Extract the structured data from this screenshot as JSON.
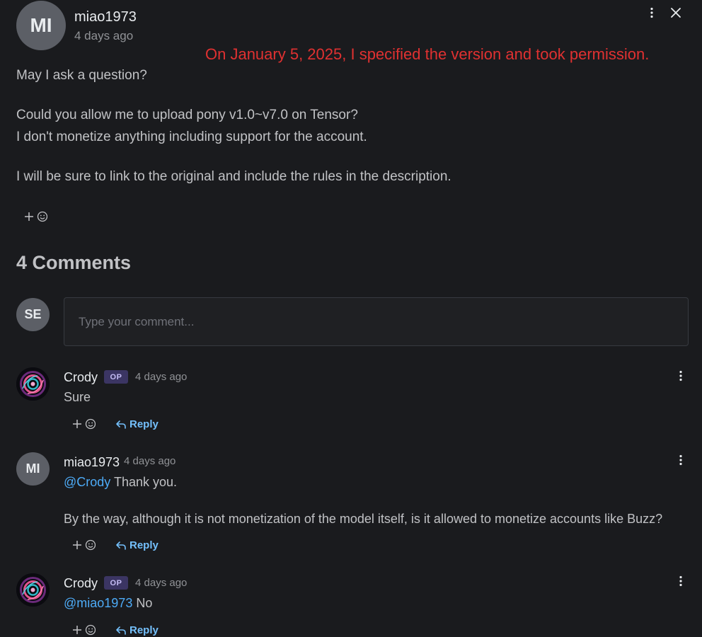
{
  "post": {
    "avatar_initials": "MI",
    "author": "miao1973",
    "time": "4 days ago",
    "annotation": "On January 5, 2025, I specified the version and took permission.",
    "body": [
      "May I ask a question?",
      "Could you allow me to upload pony v1.0~v7.0 on Tensor?",
      "I don't monetize anything including support for the account.",
      "I will be sure to link to the original and include the rules in the description."
    ]
  },
  "comments_section": {
    "title": "4 Comments",
    "current_user_initials": "SE",
    "input_placeholder": "Type your comment..."
  },
  "comments": [
    {
      "author": "Crody",
      "badge": "OP",
      "time": "4 days ago",
      "mention": "",
      "text": "Sure",
      "extra": "",
      "reply_label": "Reply"
    },
    {
      "author": "miao1973",
      "avatar_initials": "MI",
      "time": "4 days ago",
      "mention": "@Crody",
      "text": " Thank you.",
      "extra": "By the way, although it is not monetization of the model itself, is it allowed to monetize accounts like Buzz?",
      "reply_label": "Reply"
    },
    {
      "author": "Crody",
      "badge": "OP",
      "time": "4 days ago",
      "mention": "@miao1973",
      "text": " No",
      "extra": "",
      "reply_label": "Reply"
    }
  ],
  "colors": {
    "background": "#1a1b1e",
    "annotation": "#e03131",
    "link": "#4dabf7",
    "badge_bg": "#3b3563"
  },
  "icons": [
    "more-vertical-icon",
    "close-icon",
    "add-reaction-icon",
    "reply-icon"
  ]
}
